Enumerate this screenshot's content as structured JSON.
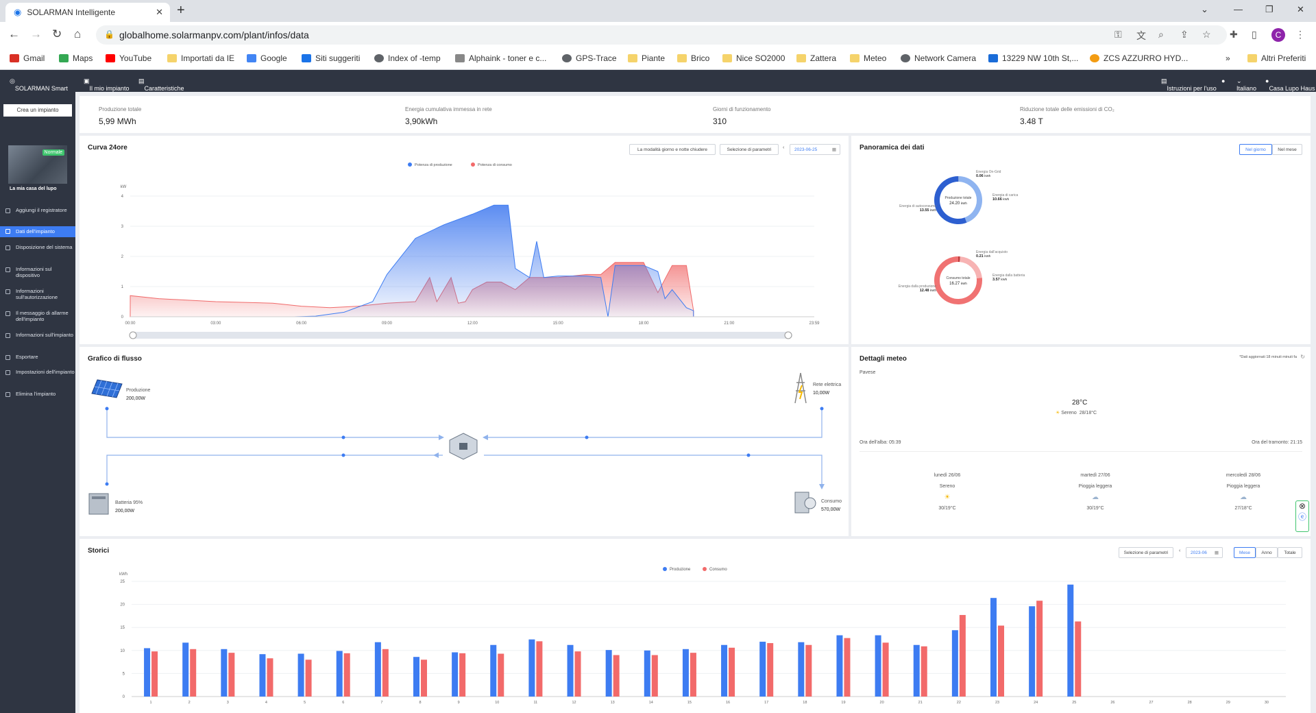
{
  "browser": {
    "tab_title": "SOLARMAN Intelligente",
    "url": "globalhome.solarmanpv.com/plant/infos/data",
    "avatar_letter": "C",
    "bookmarks": [
      "Gmail",
      "Maps",
      "YouTube",
      "Importati da IE",
      "Google",
      "Siti suggeriti",
      "Index of -temp",
      "Alphaink - toner e c...",
      "GPS-Trace",
      "Piante",
      "Brico",
      "Nice SO2000",
      "Zattera",
      "Meteo",
      "Network Camera",
      "13229 NW 10th St,...",
      "ZCS AZZURRO HYD...",
      "»",
      "Altri Preferiti"
    ]
  },
  "app": {
    "brand": "SOLARMAN Smart",
    "nav": [
      "Il mio impianto",
      "Caratteristiche"
    ],
    "right": [
      "Istruzioni per l'uso",
      "Italiano",
      "Casa Lupo Haus"
    ]
  },
  "sidebar": {
    "create_button": "Crea un impianto",
    "badge": "Normale",
    "plant_name": "La mia casa del lupo",
    "items": [
      "Aggiungi il registratore",
      "Dati dell'impianto",
      "Disposizione del sistema",
      "Informazioni sul dispositivo",
      "Informazioni sull'autorizzazione",
      "Il messaggio di allarme dell'impianto",
      "Informazioni sull'impianto",
      "Esportare",
      "Impostazioni dell'impianto",
      "Elimina l'impianto"
    ]
  },
  "stats": [
    {
      "label": "Produzione totale",
      "value": "5,99 MWh"
    },
    {
      "label": "Energia cumulativa immessa in rete",
      "value": "3,90kWh"
    },
    {
      "label": "Giorni di funzionamento",
      "value": "310"
    },
    {
      "label": "Riduzione totale delle emissioni di CO₂",
      "value": "3.48 T"
    }
  ],
  "curve": {
    "title": "Curva 24ore",
    "btn_daynight": "La modalità giorno e notte chiudere",
    "btn_params": "Selezione di parametri",
    "date": "2023-06-25",
    "legend": [
      "Potenza di produzione",
      "Potenza di consumo"
    ],
    "unit": "kW",
    "yticks": [
      "4",
      "3",
      "2",
      "1",
      "0"
    ],
    "xticks": [
      "00:00",
      "03:00",
      "06:00",
      "09:00",
      "12:00",
      "15:00",
      "18:00",
      "21:00",
      "23:59"
    ]
  },
  "overview": {
    "title": "Panoramica dei dati",
    "tabs": [
      "Nel giorno",
      "Nel mese"
    ],
    "donut1": {
      "center_label": "Produzione totale",
      "center_value": "24.20",
      "center_unit": "kWh",
      "labels": [
        {
          "name": "Energia On-Grid",
          "value": "0.06",
          "unit": "kWh"
        },
        {
          "name": "Energia di carica",
          "value": "10.66",
          "unit": "kWh"
        },
        {
          "name": "Energia di autoconsumo",
          "value": "13.55",
          "unit": "kWh"
        }
      ]
    },
    "donut2": {
      "center_label": "Consumo totale",
      "center_value": "16.27",
      "center_unit": "kWh",
      "labels": [
        {
          "name": "Energia dall'acquisto",
          "value": "0.21",
          "unit": "kWh"
        },
        {
          "name": "Energia dalla batteria",
          "value": "3.57",
          "unit": "kWh"
        },
        {
          "name": "Energia dalla produzione",
          "value": "12.48",
          "unit": "kWh"
        }
      ]
    }
  },
  "flow": {
    "title": "Grafico di flusso",
    "production": {
      "label": "Produzione",
      "value": "200,00W"
    },
    "grid": {
      "label": "Rete elettrica",
      "value": "10,00W"
    },
    "battery": {
      "label": "Batteria",
      "pct": "95%",
      "value": "200,00W"
    },
    "consumption": {
      "label": "Consumo",
      "value": "570,00W"
    }
  },
  "weather": {
    "title": "Dettagli meteo",
    "updated": "*Dati aggiornati 18 minuti minuti fa",
    "location": "Pavese",
    "temp": "28°C",
    "condition": "Sereno",
    "range": "28/18°C",
    "sunrise": "Ora dell'alba: 05:39",
    "sunset": "Ora del tramonto: 21:15",
    "forecast": [
      {
        "day": "lunedì 26/06",
        "cond": "Sereno",
        "range": "30/19°C",
        "icon": "sun-icon"
      },
      {
        "day": "martedì 27/06",
        "cond": "Pioggia leggera",
        "range": "30/19°C",
        "icon": "rain-icon"
      },
      {
        "day": "mercoledì 28/06",
        "cond": "Pioggia leggera",
        "range": "27/18°C",
        "icon": "rain-icon"
      }
    ]
  },
  "history": {
    "title": "Storici",
    "btn_params": "Selezione di parametri",
    "date": "2023-06",
    "tabs": [
      "Mese",
      "Anno",
      "Totale"
    ],
    "legend": [
      "Produzione",
      "Consumo"
    ],
    "unit": "kWh",
    "yticks": [
      "25",
      "20",
      "15",
      "10",
      "5",
      "0"
    ]
  },
  "colors": {
    "production": "#3d7cf2",
    "consumption": "#f26a6a",
    "header": "#2f3542",
    "accent": "#3d7cf2"
  },
  "chart_data": [
    {
      "type": "area",
      "title": "Curva 24ore",
      "ylabel": "kW",
      "ylim": [
        0,
        4
      ],
      "xlim": [
        "00:00",
        "23:59"
      ],
      "series": [
        {
          "name": "Potenza di produzione",
          "x": [
            "00:00",
            "05:45",
            "06:30",
            "07:30",
            "08:30",
            "09:00",
            "10:00",
            "11:00",
            "12:00",
            "12:45",
            "13:15",
            "13:30",
            "14:00",
            "14:15",
            "14:30",
            "15:00",
            "16:00",
            "16:30",
            "16:45",
            "17:00",
            "18:00",
            "18:30",
            "18:45",
            "19:00",
            "19:30",
            "19:45"
          ],
          "y": [
            0,
            0,
            0.02,
            0.15,
            0.5,
            1.4,
            2.6,
            3.05,
            3.4,
            3.7,
            3.7,
            1.6,
            1.3,
            2.5,
            1.3,
            1.35,
            1.35,
            1.3,
            0,
            1.7,
            1.7,
            1.5,
            0.6,
            0.9,
            0.3,
            0.2
          ]
        },
        {
          "name": "Potenza di consumo",
          "x": [
            "00:00",
            "01:00",
            "03:00",
            "05:00",
            "06:00",
            "07:00",
            "08:00",
            "09:00",
            "10:00",
            "10:30",
            "10:45",
            "11:15",
            "11:30",
            "11:45",
            "12:00",
            "12:30",
            "13:00",
            "13:30",
            "14:00",
            "15:00",
            "16:00",
            "16:30",
            "17:00",
            "18:00",
            "18:30",
            "19:00",
            "19:30",
            "19:45"
          ],
          "y": [
            0.7,
            0.6,
            0.5,
            0.45,
            0.35,
            0.3,
            0.35,
            0.45,
            0.5,
            1.3,
            0.5,
            1.3,
            0.45,
            0.5,
            0.9,
            1.15,
            1.15,
            0.9,
            1.3,
            1.3,
            1.4,
            1.4,
            1.8,
            1.8,
            0.8,
            1.7,
            1.7,
            0.2
          ]
        }
      ]
    },
    {
      "type": "pie",
      "title": "Produzione totale",
      "categories": [
        "Energia On-Grid",
        "Energia di carica",
        "Energia di autoconsumo"
      ],
      "values": [
        0.06,
        10.66,
        13.55
      ]
    },
    {
      "type": "pie",
      "title": "Consumo totale",
      "categories": [
        "Energia dall'acquisto",
        "Energia dalla batteria",
        "Energia dalla produzione"
      ],
      "values": [
        0.21,
        3.57,
        12.48
      ]
    },
    {
      "type": "bar",
      "title": "Storici",
      "ylabel": "kWh",
      "ylim": [
        0,
        25
      ],
      "categories": [
        "1",
        "2",
        "3",
        "4",
        "5",
        "6",
        "7",
        "8",
        "9",
        "10",
        "11",
        "12",
        "13",
        "14",
        "15",
        "16",
        "17",
        "18",
        "19",
        "20",
        "21",
        "22",
        "23",
        "24",
        "25",
        "26",
        "27",
        "28",
        "29",
        "30"
      ],
      "series": [
        {
          "name": "Produzione",
          "values": [
            10.5,
            11.7,
            10.3,
            9.2,
            9.3,
            9.9,
            11.8,
            8.6,
            9.6,
            11.2,
            12.4,
            11.2,
            10.1,
            10.0,
            10.3,
            11.2,
            11.9,
            11.8,
            13.3,
            13.3,
            11.2,
            14.4,
            21.4,
            19.6,
            24.3,
            null,
            null,
            null,
            null,
            null
          ]
        },
        {
          "name": "Consumo",
          "values": [
            9.8,
            10.3,
            9.5,
            8.3,
            8.0,
            9.4,
            10.3,
            8.0,
            9.4,
            9.3,
            12.0,
            9.8,
            9.0,
            9.0,
            9.5,
            10.6,
            11.6,
            11.2,
            12.7,
            11.7,
            10.9,
            17.7,
            15.4,
            20.8,
            16.3,
            null,
            null,
            null,
            null,
            null
          ]
        }
      ]
    }
  ]
}
